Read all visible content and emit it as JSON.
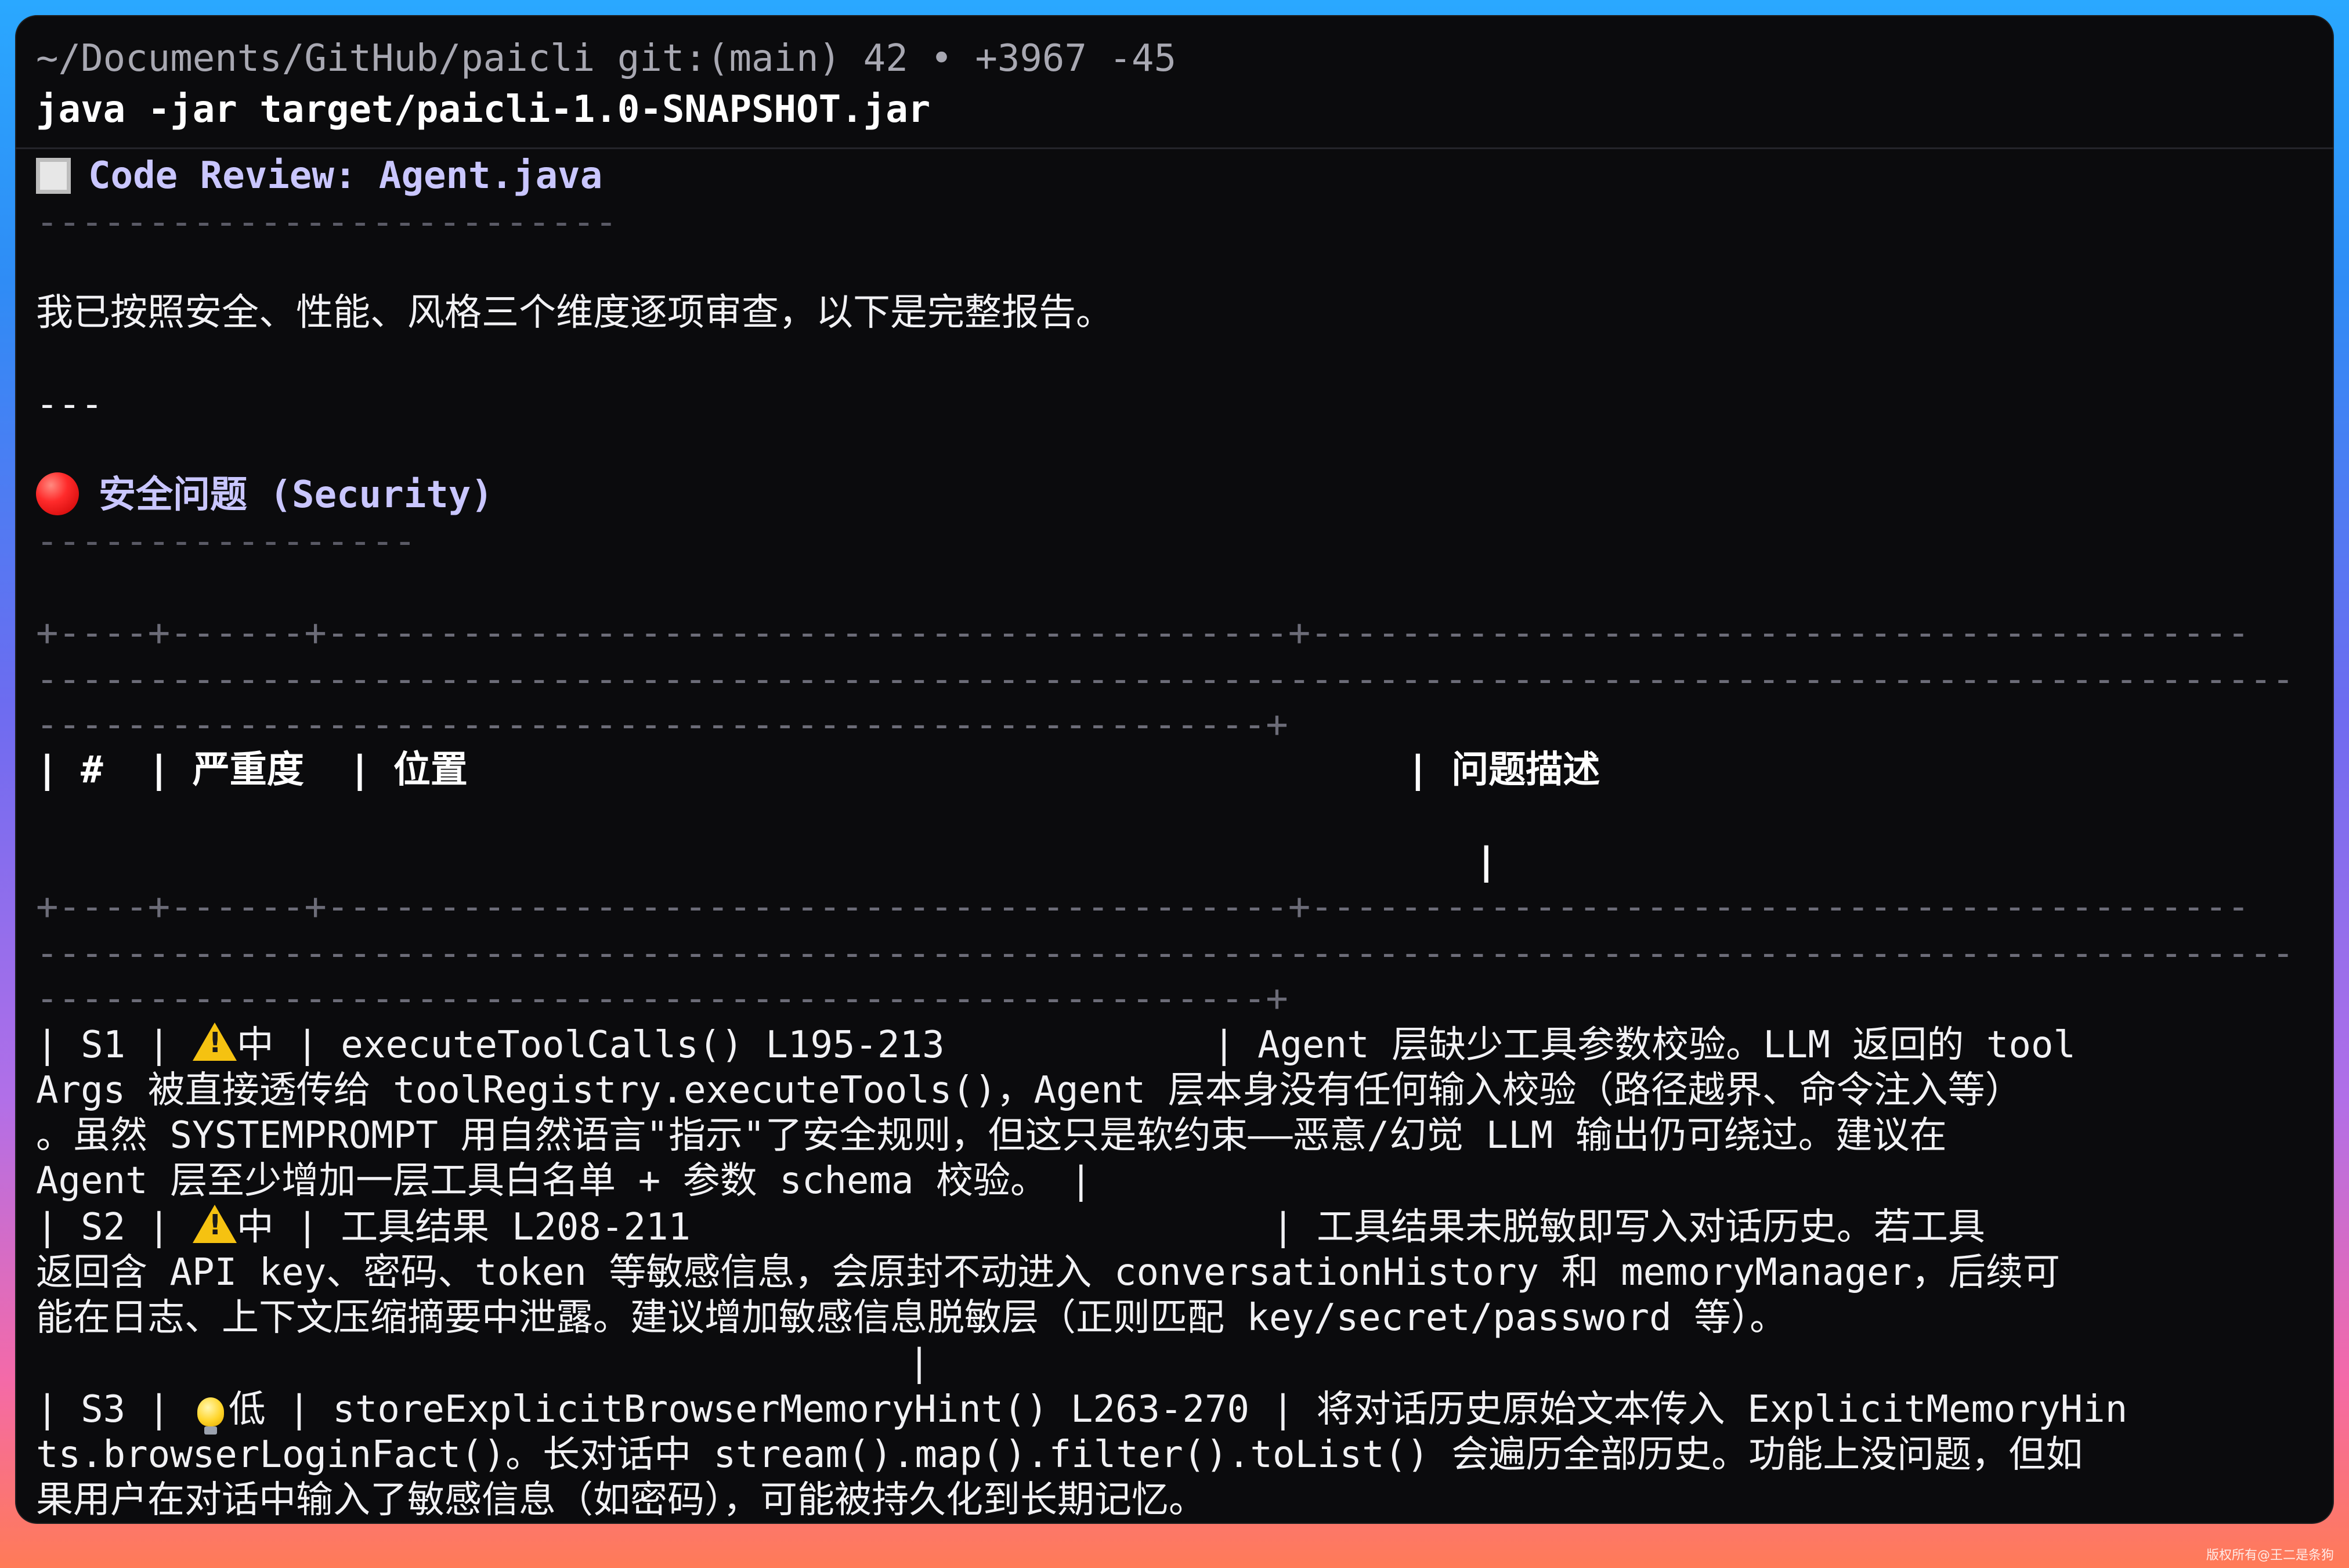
{
  "terminal": {
    "prompt_path": "~/Documents/GitHub/paicli git:(main) 42 • +3967 -45",
    "command": "java -jar target/paicli-1.0-SNAPSHOT.jar"
  },
  "review": {
    "title": "Code Review: Agent.java",
    "title_rule": "--------------------------",
    "intro": "我已按照安全、性能、风格三个维度逐项审查，以下是完整报告。",
    "separator": "---"
  },
  "security_section": {
    "title": "安全问题 (Security)",
    "rule": "-----------------"
  },
  "table": {
    "border_line_1": "+----+------+-------------------------------------------+------------------------------------------",
    "border_line_2": "-----------------------------------------------------------------------------------------------------",
    "border_line_3": "-------------------------------------------------------+",
    "header_row": "| #  | 严重度  | 位置                                          | 问题描述",
    "header_pipe": "|",
    "rows_lines": [
      {
        "pre": "| S1 | ",
        "icon": "warning-icon",
        "post": "中 | executeToolCalls() L195-213            | Agent 层缺少工具参数校验。LLM 返回的 tool"
      },
      {
        "pre": "Args 被直接透传给 toolRegistry.executeTools()，Agent 层本身没有任何输入校验（路径越界、命令注入等）",
        "icon": "",
        "post": ""
      },
      {
        "pre": "。虽然 SYSTEMPROMPT 用自然语言\"指示\"了安全规则，但这只是软约束——恶意/幻觉 LLM 输出仍可绕过。建议在",
        "icon": "",
        "post": ""
      },
      {
        "pre": "Agent 层至少增加一层工具白名单 + 参数 schema 校验。 |",
        "icon": "",
        "post": ""
      },
      {
        "pre": "| S2 | ",
        "icon": "warning-icon",
        "post": "中 | 工具结果 L208-211                          | 工具结果未脱敏即写入对话历史。若工具"
      },
      {
        "pre": "返回含 API key、密码、token 等敏感信息，会原封不动进入 conversationHistory 和 memoryManager，后续可",
        "icon": "",
        "post": ""
      },
      {
        "pre": "能在日志、上下文压缩摘要中泄露。建议增加敏感信息脱敏层（正则匹配 key/secret/password 等）。",
        "icon": "",
        "post": ""
      },
      {
        "pre": "                                       |",
        "icon": "",
        "post": ""
      },
      {
        "pre": "| S3 | ",
        "icon": "bulb-icon",
        "post": "低 | storeExplicitBrowserMemoryHint() L263-270 | 将对话历史原始文本传入 ExplicitMemoryHin"
      },
      {
        "pre": "ts.browserLoginFact()。长对话中 stream().map().filter().toList() 会遍历全部历史。功能上没问题，但如",
        "icon": "",
        "post": ""
      },
      {
        "pre": "果用户在对话中输入了敏感信息（如密码），可能被持久化到长期记忆。",
        "icon": "",
        "post": ""
      }
    ]
  },
  "watermark": "版权所有@王二是条狗"
}
